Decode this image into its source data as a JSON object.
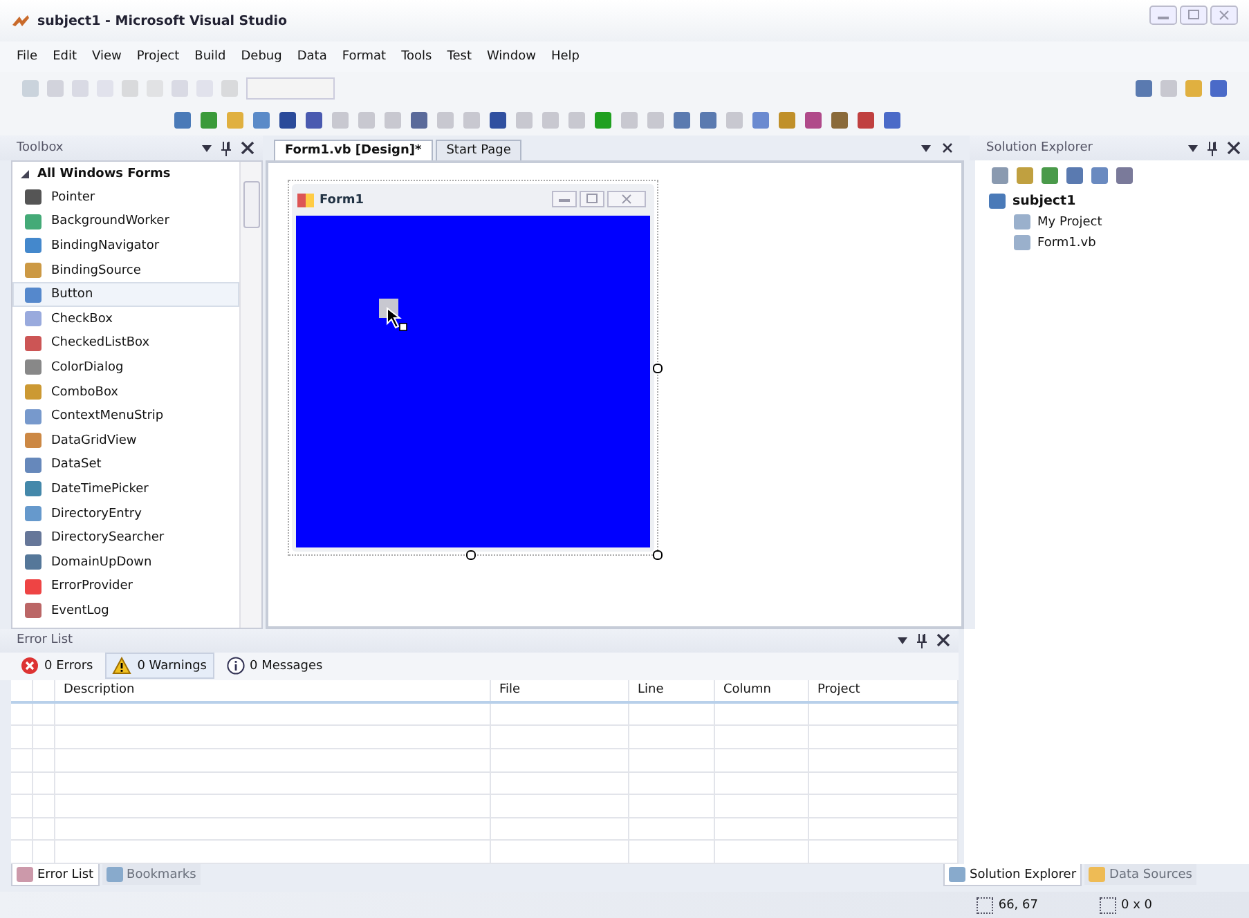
{
  "window": {
    "title": "subject1 - Microsoft Visual Studio"
  },
  "menu": [
    "File",
    "Edit",
    "View",
    "Project",
    "Build",
    "Debug",
    "Data",
    "Format",
    "Tools",
    "Test",
    "Window",
    "Help"
  ],
  "toolbox": {
    "title": "Toolbox",
    "group": {
      "label": "All Windows Forms",
      "expanded": true
    },
    "items": [
      {
        "label": "Pointer",
        "selected": false
      },
      {
        "label": "BackgroundWorker",
        "selected": false
      },
      {
        "label": "BindingNavigator",
        "selected": false
      },
      {
        "label": "BindingSource",
        "selected": false
      },
      {
        "label": "Button",
        "selected": true
      },
      {
        "label": "CheckBox",
        "selected": false
      },
      {
        "label": "CheckedListBox",
        "selected": false
      },
      {
        "label": "ColorDialog",
        "selected": false
      },
      {
        "label": "ComboBox",
        "selected": false
      },
      {
        "label": "ContextMenuStrip",
        "selected": false
      },
      {
        "label": "DataGridView",
        "selected": false
      },
      {
        "label": "DataSet",
        "selected": false
      },
      {
        "label": "DateTimePicker",
        "selected": false
      },
      {
        "label": "DirectoryEntry",
        "selected": false
      },
      {
        "label": "DirectorySearcher",
        "selected": false
      },
      {
        "label": "DomainUpDown",
        "selected": false
      },
      {
        "label": "ErrorProvider",
        "selected": false
      },
      {
        "label": "EventLog",
        "selected": false
      }
    ]
  },
  "documents": {
    "tabs": [
      {
        "label": "Form1.vb [Design]*",
        "selected": true
      },
      {
        "label": "Start Page",
        "selected": false
      }
    ],
    "form": {
      "title": "Form1"
    }
  },
  "solution_explorer": {
    "title": "Solution Explorer",
    "tree": [
      {
        "label": "subject1",
        "children": [
          {
            "label": "My Project"
          },
          {
            "label": "Form1.vb"
          }
        ]
      }
    ]
  },
  "error_list": {
    "title": "Error List",
    "filters": [
      {
        "label": "0 Errors",
        "kind": "error",
        "selected": false
      },
      {
        "label": "0 Warnings",
        "kind": "warning",
        "selected": true
      },
      {
        "label": "0 Messages",
        "kind": "info",
        "selected": false
      }
    ],
    "columns": [
      "Description",
      "File",
      "Line",
      "Column",
      "Project"
    ]
  },
  "bottom_tabs_left": [
    {
      "label": "Error List",
      "selected": true
    },
    {
      "label": "Bookmarks",
      "selected": false
    }
  ],
  "bottom_tabs_right": [
    {
      "label": "Solution Explorer",
      "selected": true
    },
    {
      "label": "Data Sources",
      "selected": false
    }
  ],
  "status_bar": {
    "position": "66, 67",
    "size": "0 x 0"
  }
}
